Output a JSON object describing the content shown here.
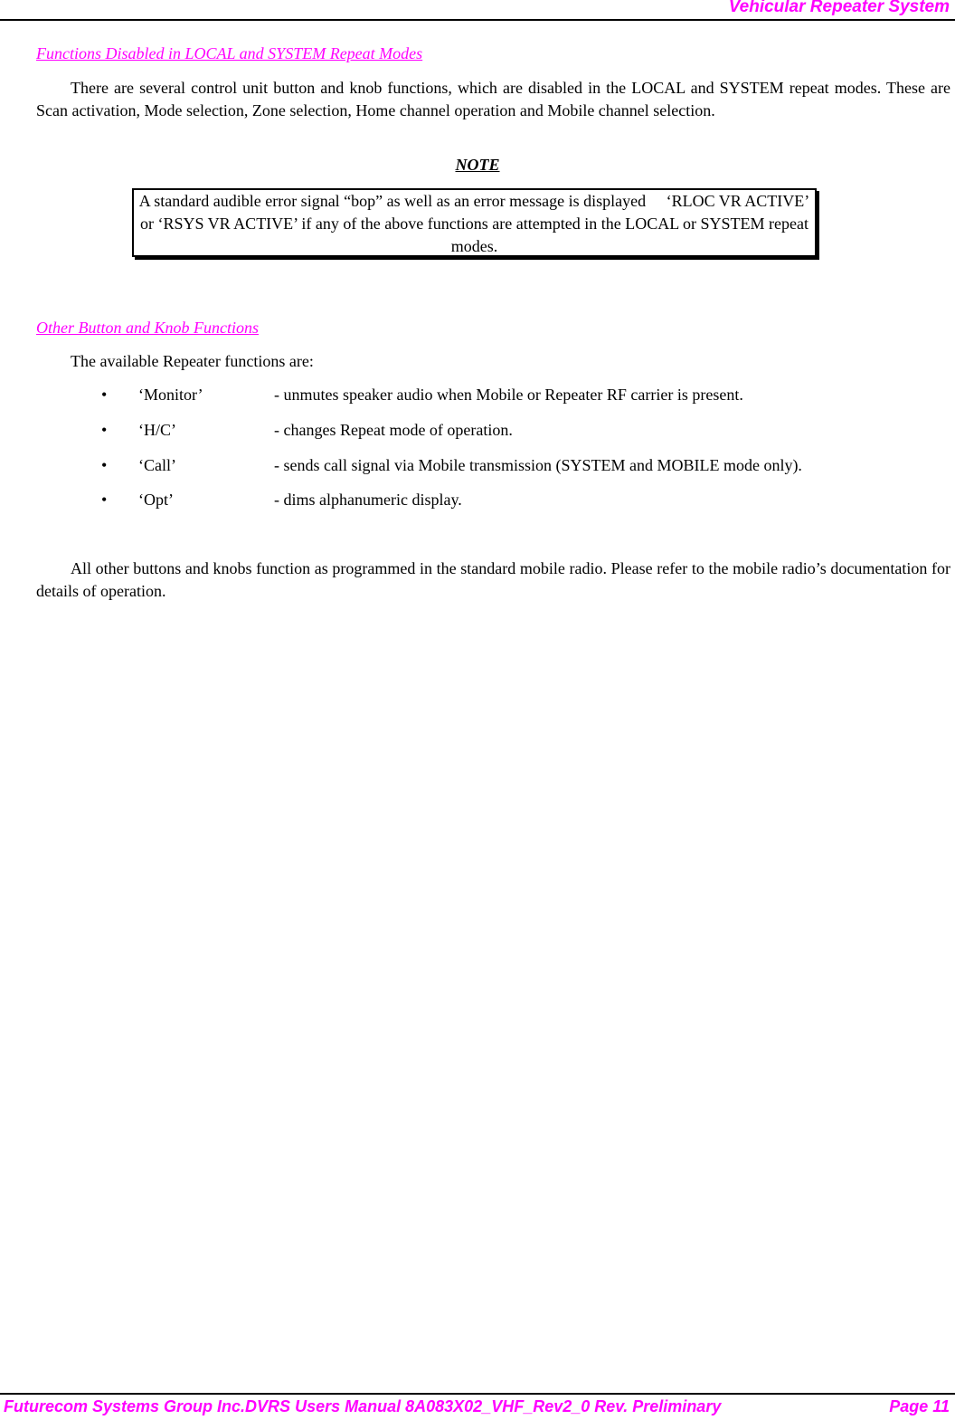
{
  "header": {
    "title": "Vehicular Repeater System"
  },
  "section1": {
    "heading": "Functions Disabled in LOCAL and SYSTEM Repeat Modes",
    "paragraph": "There are several control unit button and knob functions, which are disabled in the LOCAL and SYSTEM repeat modes.  These are Scan activation, Mode selection, Zone selection, Home channel operation and Mobile channel selection."
  },
  "note": {
    "label": "NOTE",
    "text": "A standard audible error signal “bop” as well as an error message is displayed     ‘RLOC VR ACTIVE’ or ‘RSYS VR ACTIVE’ if any of the above functions are attempted in the LOCAL or SYSTEM repeat modes."
  },
  "section2": {
    "heading": "Other Button and Knob Functions",
    "intro": "The available Repeater functions are:",
    "functions": [
      {
        "name": "‘Monitor’",
        "description": "- unmutes speaker audio when Mobile or Repeater RF carrier is present."
      },
      {
        "name": "‘H/C’",
        "description": "- changes Repeat mode of operation."
      },
      {
        "name": "‘Call’",
        "description": "- sends call signal via Mobile transmission (SYSTEM and MOBILE mode only)."
      },
      {
        "name": "‘Opt’",
        "description": "- dims alphanumeric display."
      }
    ],
    "closing": "All other buttons and knobs function as programmed in the standard mobile radio. Please refer to the mobile radio’s documentation for details of operation."
  },
  "footer": {
    "text": "Futurecom Systems Group Inc.DVRS Users Manual 8A083X02_VHF_Rev2_0 Rev. Preliminary",
    "page": "Page 11"
  },
  "colors": {
    "accent": "#ff00ff",
    "text": "#000000"
  }
}
